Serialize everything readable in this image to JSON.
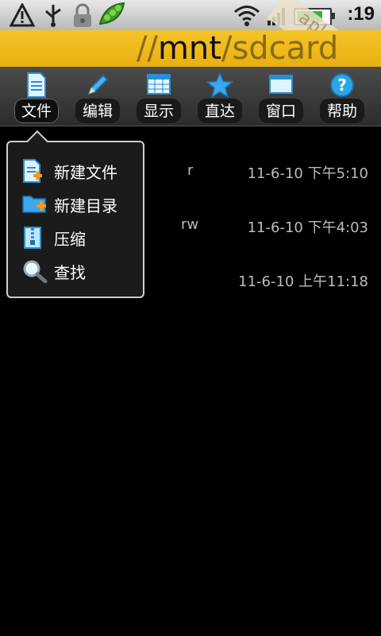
{
  "status_bar": {
    "time": ":19",
    "watermark": "apk8.com",
    "icons": [
      "warning-icon",
      "usb-icon",
      "lock-icon",
      "pea-pod-icon",
      "wifi-icon",
      "signal-icon",
      "battery-icon"
    ]
  },
  "path_bar": {
    "prefix": "//",
    "current": "mnt",
    "separator": "/",
    "trailing": "sdcard"
  },
  "toolbar": {
    "items": [
      {
        "label": "文件",
        "icon": "document-icon"
      },
      {
        "label": "编辑",
        "icon": "pencil-icon"
      },
      {
        "label": "显示",
        "icon": "grid-view-icon"
      },
      {
        "label": "直达",
        "icon": "star-icon"
      },
      {
        "label": "窗口",
        "icon": "window-icon"
      },
      {
        "label": "帮助",
        "icon": "help-icon"
      }
    ]
  },
  "files": [
    {
      "permission": "r",
      "date": "11-6-10 下午5:10"
    },
    {
      "permission": "rw",
      "date": "11-6-10 下午4:03"
    },
    {
      "permission": "",
      "date": "11-6-10 上午11:18"
    }
  ],
  "file_menu": {
    "items": [
      {
        "label": "新建文件",
        "icon": "new-file-icon"
      },
      {
        "label": "新建目录",
        "icon": "new-folder-icon"
      },
      {
        "label": "压缩",
        "icon": "compress-icon"
      },
      {
        "label": "查找",
        "icon": "search-icon"
      }
    ]
  },
  "colors": {
    "path_bar": "#f0bc1c",
    "toolbar": "#3a3a3a",
    "background": "#000000",
    "accent_icon": "#2aa6e6"
  }
}
